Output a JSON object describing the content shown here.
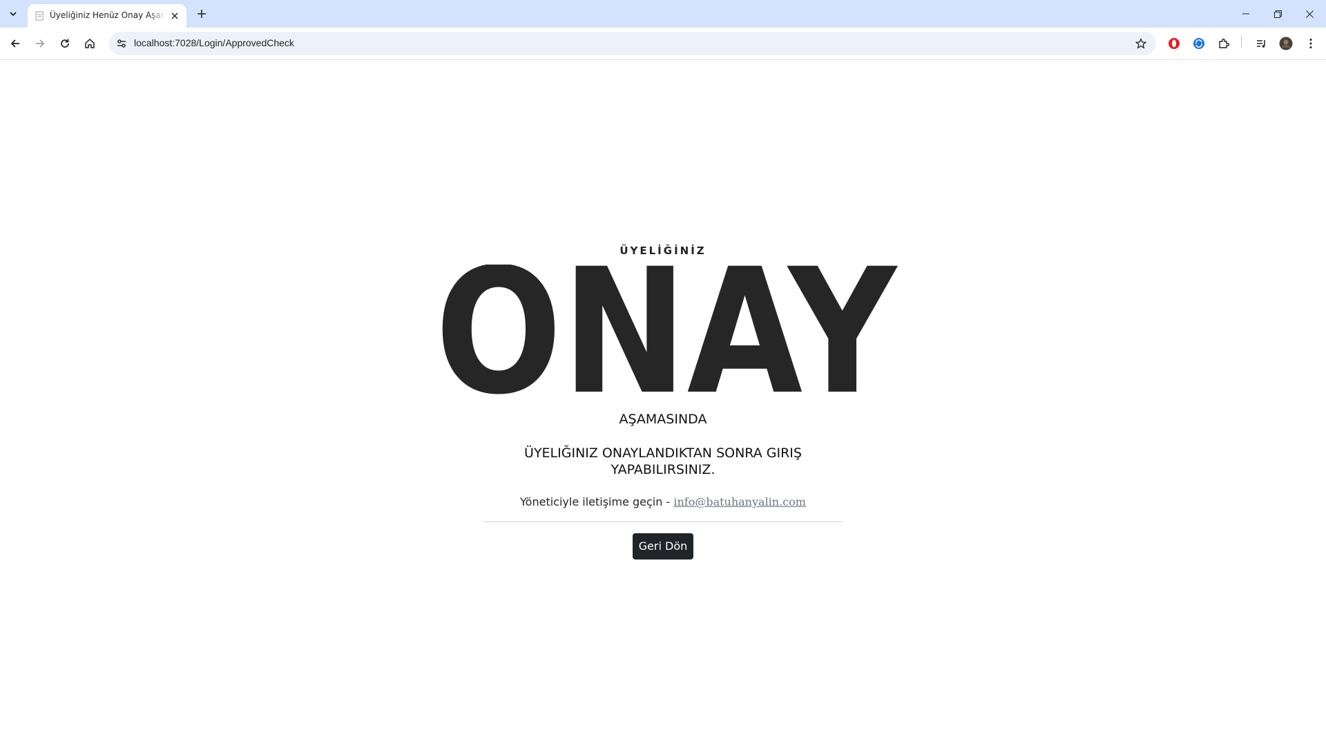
{
  "browser": {
    "tab_title": "Üyeliğiniz Henüz Onay Aşamasında",
    "url": "localhost:7028/Login/ApprovedCheck",
    "icons": {
      "tab_search": "chevron-down-icon",
      "favicon": "page-icon",
      "tab_close": "close-icon",
      "new_tab": "plus-icon",
      "minimize": "minimize-icon",
      "restore": "restore-icon",
      "close_window": "close-icon",
      "back": "arrow-left-icon",
      "forward": "arrow-right-icon",
      "reload": "reload-icon",
      "home": "home-icon",
      "site_info": "tune-icon",
      "bookmark": "star-icon",
      "opera_ext": "opera-icon",
      "blue_ext": "extension-blue-icon",
      "extensions": "puzzle-icon",
      "media": "media-control-icon",
      "profile": "avatar",
      "menu": "kebab-menu-icon"
    }
  },
  "page": {
    "subtitle_top": "ÜYELİĞİNİZ",
    "hero_word": "ONAY",
    "subtitle_bottom": "AŞAMASINDA",
    "message": "ÜYELIĞINIZ ONAYLANDIKTAN SONRA GIRIŞ YAPABILIRSINIZ.",
    "contact_text": "Yöneticiyle iletişime geçin - ",
    "contact_email": "info@batuhanyalin.com",
    "back_button": "Geri Dön"
  },
  "colors": {
    "tabstrip": "#d3e3fd",
    "omnibox": "#edf2fa",
    "hero": "#262626",
    "button_bg": "#212529",
    "link": "#6c757d"
  }
}
